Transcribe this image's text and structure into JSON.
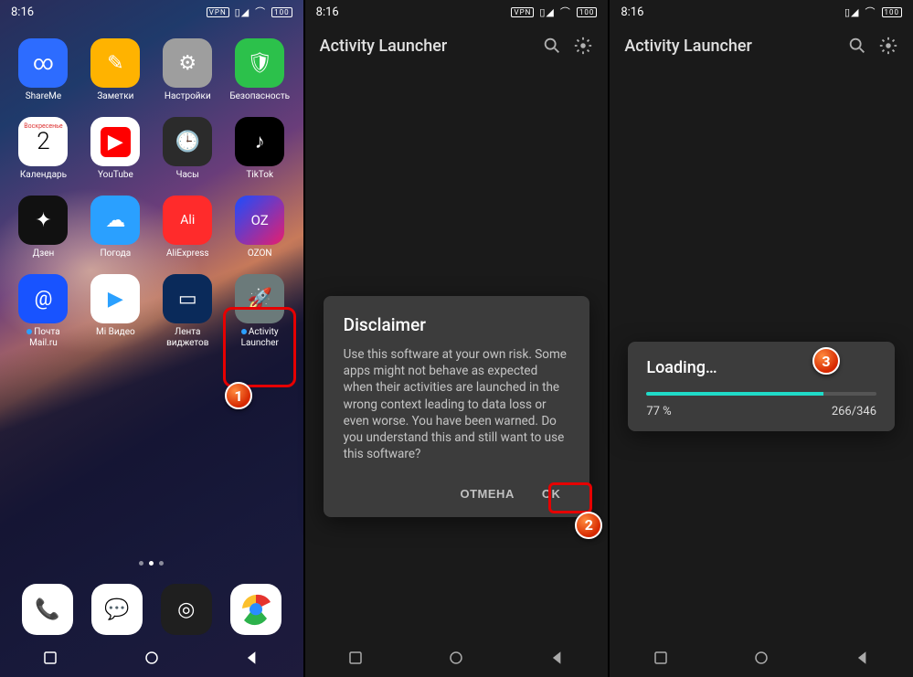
{
  "status": {
    "time": "8:16",
    "vpn": "VPN",
    "signal": "▮▮▮▮",
    "wifi": "⧋",
    "battery": "100"
  },
  "home": {
    "apps": [
      {
        "id": "shareme",
        "label": "ShareMe",
        "bg": "#2d6cff",
        "glyph": "∞"
      },
      {
        "id": "notes",
        "label": "Заметки",
        "bg": "#ffb300",
        "glyph": "✎"
      },
      {
        "id": "settings",
        "label": "Настройки",
        "bg": "#9e9e9e",
        "glyph": "⚙"
      },
      {
        "id": "security",
        "label": "Безопасность",
        "bg": "#2cc14b",
        "glyph": "🛡"
      },
      {
        "id": "calendar",
        "label": "Календарь",
        "bg": "#ffffff",
        "glyph": "2",
        "sub": "Воскресенье",
        "fg": "#000"
      },
      {
        "id": "youtube",
        "label": "YouTube",
        "bg": "#ffffff",
        "glyph": "▶",
        "glyphbg": "#ff0000"
      },
      {
        "id": "clock",
        "label": "Часы",
        "bg": "#2b2b2b",
        "glyph": "🕒"
      },
      {
        "id": "tiktok",
        "label": "TikTok",
        "bg": "#000000",
        "glyph": "♪"
      },
      {
        "id": "dzen",
        "label": "Дзен",
        "bg": "#111111",
        "glyph": "✦"
      },
      {
        "id": "weather",
        "label": "Погода",
        "bg": "#2aa0ff",
        "glyph": "☁"
      },
      {
        "id": "ali",
        "label": "AliExpress",
        "bg": "#ff2b2b",
        "glyph": "Ali",
        "glyphsize": "14px"
      },
      {
        "id": "ozon",
        "label": "OZON",
        "bg": "#1a4dff",
        "glyph": "OZ",
        "glyphsize": "15px",
        "grad": "linear-gradient(135deg,#1a4dff,#e61e6e)"
      },
      {
        "id": "mail",
        "label": "Почта\nMail.ru",
        "bg": "#1853ff",
        "glyph": "@",
        "dot": true
      },
      {
        "id": "mivideo",
        "label": "Mi Видео",
        "bg": "#ffffff",
        "glyph": "▶",
        "fg": "#2aa0ff"
      },
      {
        "id": "widgets",
        "label": "Лента\nвиджетов",
        "bg": "#0a2a5a",
        "glyph": "▭"
      },
      {
        "id": "activity",
        "label": "Activity\nLauncher",
        "bg": "#6b7a7a",
        "glyph": "🚀",
        "dot": true
      }
    ],
    "dock": [
      {
        "id": "phone",
        "bg": "#ffffff",
        "glyph": "📞",
        "fg": "#1a73e8"
      },
      {
        "id": "messages",
        "bg": "#ffffff",
        "glyph": "💬",
        "fg": "#1a73e8"
      },
      {
        "id": "camera",
        "bg": "#1f1f1f",
        "glyph": "◎"
      },
      {
        "id": "chrome",
        "bg": "#ffffff",
        "glyph": "◯",
        "chrome": true
      }
    ]
  },
  "appbar": {
    "title": "Activity Launcher"
  },
  "dialog": {
    "title": "Disclaimer",
    "body": "Use this software at your own risk. Some apps might not behave as expected when their activities are launched in the wrong context leading to data loss or even worse. You have been warned. Do you understand this and still want to use this software?",
    "cancel": "ОТМЕНА",
    "ok": "OK"
  },
  "loading": {
    "title": "Loading…",
    "percent_text": "77 %",
    "count_text": "266/346",
    "percent": 77
  },
  "badges": {
    "b1": "1",
    "b2": "2",
    "b3": "3"
  }
}
